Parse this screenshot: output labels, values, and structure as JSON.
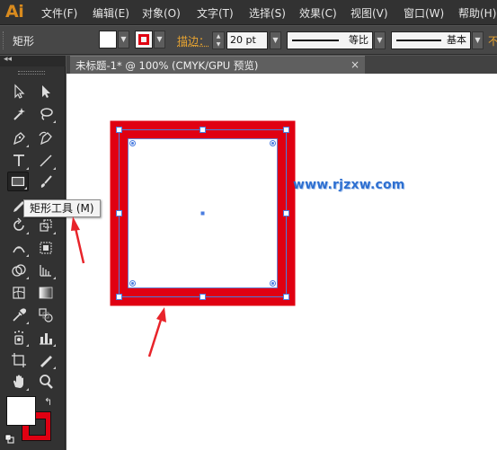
{
  "app": {
    "logo": "Ai"
  },
  "menu": {
    "items": [
      {
        "label": "文件(F)"
      },
      {
        "label": "编辑(E)"
      },
      {
        "label": "对象(O)"
      },
      {
        "label": "文字(T)"
      },
      {
        "label": "选择(S)"
      },
      {
        "label": "效果(C)"
      },
      {
        "label": "视图(V)"
      },
      {
        "label": "窗口(W)"
      },
      {
        "label": "帮助(H)"
      }
    ]
  },
  "control": {
    "tool_name": "矩形",
    "fill_color": "#ffffff",
    "stroke_color": "#e00012",
    "stroke_label": "描边：",
    "stroke_weight": "20 pt",
    "variable_width": "等比",
    "brush": "基本",
    "overflow_char": "不"
  },
  "toolbar": {
    "collapse_label": "◂◂",
    "fill": "#ffffff",
    "stroke": "#e00012",
    "tools": [
      {
        "icon": "selection-tool-icon"
      },
      {
        "icon": "direct-selection-tool-icon"
      },
      {
        "icon": "magic-wand-tool-icon"
      },
      {
        "icon": "lasso-tool-icon"
      },
      {
        "icon": "pen-tool-icon"
      },
      {
        "icon": "curvature-tool-icon"
      },
      {
        "icon": "type-tool-icon"
      },
      {
        "icon": "line-segment-tool-icon"
      },
      {
        "icon": "rectangle-tool-icon"
      },
      {
        "icon": "paintbrush-tool-icon"
      },
      {
        "icon": "pencil-tool-icon"
      },
      {
        "icon": "eraser-tool-icon"
      },
      {
        "icon": "rotate-tool-icon"
      },
      {
        "icon": "scale-tool-icon"
      },
      {
        "icon": "width-tool-icon"
      },
      {
        "icon": "free-transform-tool-icon"
      },
      {
        "icon": "shape-builder-tool-icon"
      },
      {
        "icon": "perspective-grid-tool-icon"
      },
      {
        "icon": "mesh-tool-icon"
      },
      {
        "icon": "gradient-tool-icon"
      },
      {
        "icon": "eyedropper-tool-icon"
      },
      {
        "icon": "blend-tool-icon"
      },
      {
        "icon": "symbol-sprayer-tool-icon"
      },
      {
        "icon": "column-graph-tool-icon"
      },
      {
        "icon": "artboard-tool-icon"
      },
      {
        "icon": "slice-tool-icon"
      },
      {
        "icon": "hand-tool-icon"
      },
      {
        "icon": "zoom-tool-icon"
      }
    ]
  },
  "tooltip": {
    "text": "矩形工具 (M)"
  },
  "document": {
    "tab_title": "未标题-1* @ 100% (CMYK/GPU 预览)",
    "close_glyph": "×"
  },
  "canvas": {
    "shape_fill": "#ffffff",
    "shape_stroke": "#e00012",
    "selection_color": "#4a7de0",
    "watermark": "www.rjzxw.com",
    "annotation_color": "#e8242a"
  }
}
